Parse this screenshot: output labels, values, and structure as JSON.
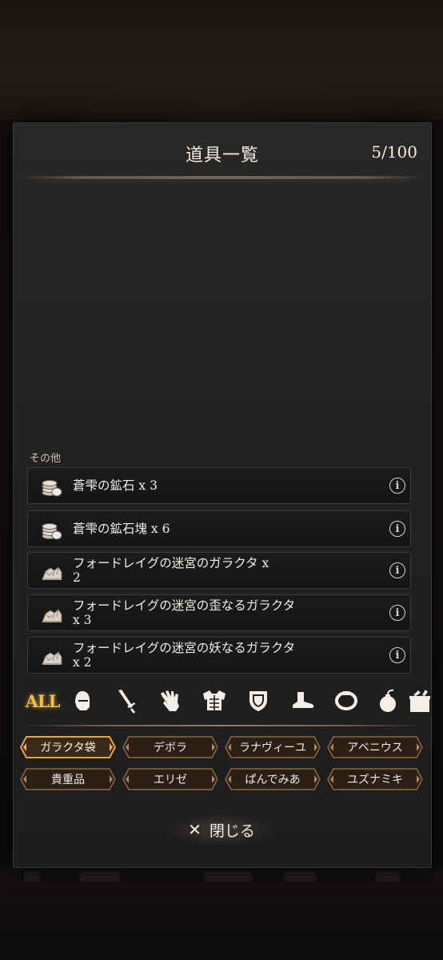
{
  "dialog": {
    "title": "道具一覧",
    "count": "5/100"
  },
  "section": {
    "label": "その他"
  },
  "items": [
    {
      "text": "蒼雫の鉱石 x 3",
      "icon": "coins-icon"
    },
    {
      "text": "蒼雫の鉱石塊 x 6",
      "icon": "coins-icon"
    },
    {
      "text": "フォードレイグの迷宮のガラクタ x\n2",
      "icon": "rubble-icon"
    },
    {
      "text": "フォードレイグの迷宮の歪なるガラクタ\nx 3",
      "icon": "rubble-icon"
    },
    {
      "text": "フォードレイグの迷宮の妖なるガラクタ\nx 2",
      "icon": "rubble-icon"
    }
  ],
  "info_glyph": "i",
  "categories": {
    "all_label": "ALL",
    "icons": [
      "head-icon",
      "sword-icon",
      "glove-icon",
      "armor-icon",
      "shield-icon",
      "boot-icon",
      "ring-icon",
      "bomb-icon",
      "box-icon"
    ]
  },
  "tabs": {
    "row1": [
      "ガラクタ袋",
      "デボラ",
      "ラナヴィーユ",
      "アベニウス"
    ],
    "row2": [
      "貴重品",
      "エリゼ",
      "ぱんでみあ",
      "ユズナミキ"
    ],
    "active": "ガラクタ袋"
  },
  "colors": {
    "accent_gold": "#e8c24a",
    "tab_frame": "#b0895a",
    "active_frame": "#e0a24a"
  },
  "close_button": {
    "icon": "close-icon",
    "label": "閉じる"
  }
}
